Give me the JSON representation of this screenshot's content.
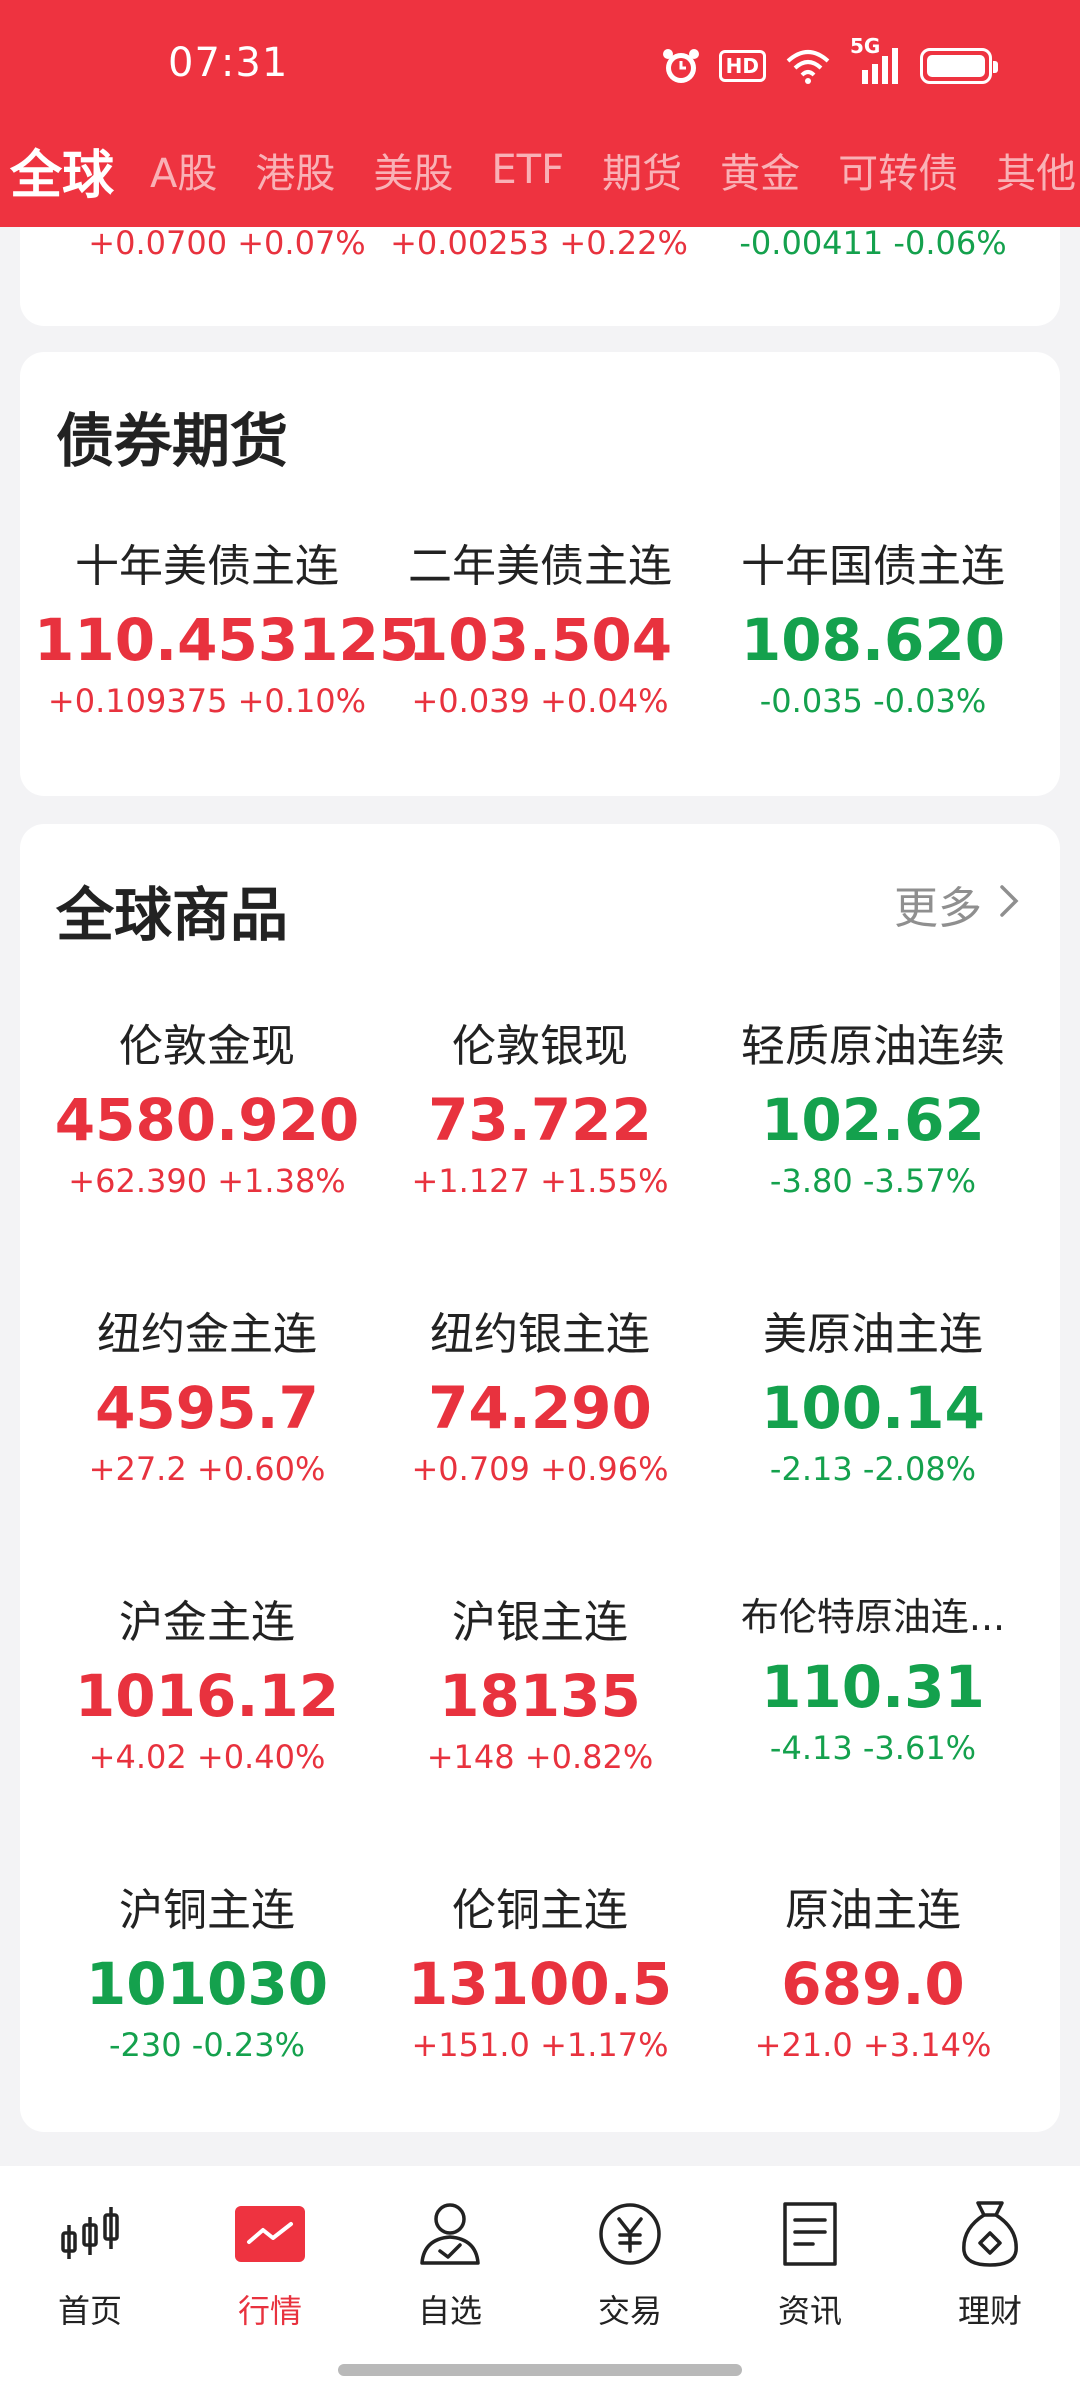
{
  "status_bar": {
    "time": "07:31",
    "hd": "HD",
    "network": "5G"
  },
  "tabs": [
    {
      "label": "全球",
      "active": true
    },
    {
      "label": "A股"
    },
    {
      "label": "港股"
    },
    {
      "label": "美股"
    },
    {
      "label": "ETF"
    },
    {
      "label": "期货"
    },
    {
      "label": "黄金"
    },
    {
      "label": "可转债"
    },
    {
      "label": "其他"
    }
  ],
  "prev_section": {
    "items": [
      {
        "change": "+0.0700 +0.07%",
        "trend": "up"
      },
      {
        "change": "+0.00253 +0.22%",
        "trend": "up"
      },
      {
        "change": "-0.00411 -0.06%",
        "trend": "down"
      }
    ]
  },
  "bond_futures": {
    "title": "债券期货",
    "items": [
      {
        "name": "十年美债主连",
        "price": "110.453125",
        "change": "+0.109375 +0.10%",
        "trend": "up"
      },
      {
        "name": "二年美债主连",
        "price": "103.504",
        "change": "+0.039 +0.04%",
        "trend": "up"
      },
      {
        "name": "十年国债主连",
        "price": "108.620",
        "change": "-0.035 -0.03%",
        "trend": "down"
      }
    ]
  },
  "commodities": {
    "title": "全球商品",
    "more_label": "更多",
    "items": [
      {
        "name": "伦敦金现",
        "price": "4580.920",
        "change": "+62.390 +1.38%",
        "trend": "up"
      },
      {
        "name": "伦敦银现",
        "price": "73.722",
        "change": "+1.127 +1.55%",
        "trend": "up"
      },
      {
        "name": "轻质原油连续",
        "price": "102.62",
        "change": "-3.80 -3.57%",
        "trend": "down"
      },
      {
        "name": "纽约金主连",
        "price": "4595.7",
        "change": "+27.2 +0.60%",
        "trend": "up"
      },
      {
        "name": "纽约银主连",
        "price": "74.290",
        "change": "+0.709 +0.96%",
        "trend": "up"
      },
      {
        "name": "美原油主连",
        "price": "100.14",
        "change": "-2.13 -2.08%",
        "trend": "down"
      },
      {
        "name": "沪金主连",
        "price": "1016.12",
        "change": "+4.02 +0.40%",
        "trend": "up"
      },
      {
        "name": "沪银主连",
        "price": "18135",
        "change": "+148 +0.82%",
        "trend": "up"
      },
      {
        "name": "布伦特原油连...",
        "price": "110.31",
        "change": "-4.13 -3.61%",
        "trend": "down"
      },
      {
        "name": "沪铜主连",
        "price": "101030",
        "change": "-230 -0.23%",
        "trend": "down"
      },
      {
        "name": "伦铜主连",
        "price": "13100.5",
        "change": "+151.0 +1.17%",
        "trend": "up"
      },
      {
        "name": "原油主连",
        "price": "689.0",
        "change": "+21.0 +3.14%",
        "trend": "up"
      }
    ]
  },
  "bottom_nav": [
    {
      "label": "首页",
      "icon": "candlestick-icon"
    },
    {
      "label": "行情",
      "icon": "trend-chart-icon",
      "active": true
    },
    {
      "label": "自选",
      "icon": "user-check-icon"
    },
    {
      "label": "交易",
      "icon": "yen-coin-icon"
    },
    {
      "label": "资讯",
      "icon": "document-icon"
    },
    {
      "label": "理财",
      "icon": "money-bag-icon"
    }
  ],
  "colors": {
    "brand_red": "#ee3340",
    "up": "#e8323e",
    "down": "#14a14d"
  }
}
